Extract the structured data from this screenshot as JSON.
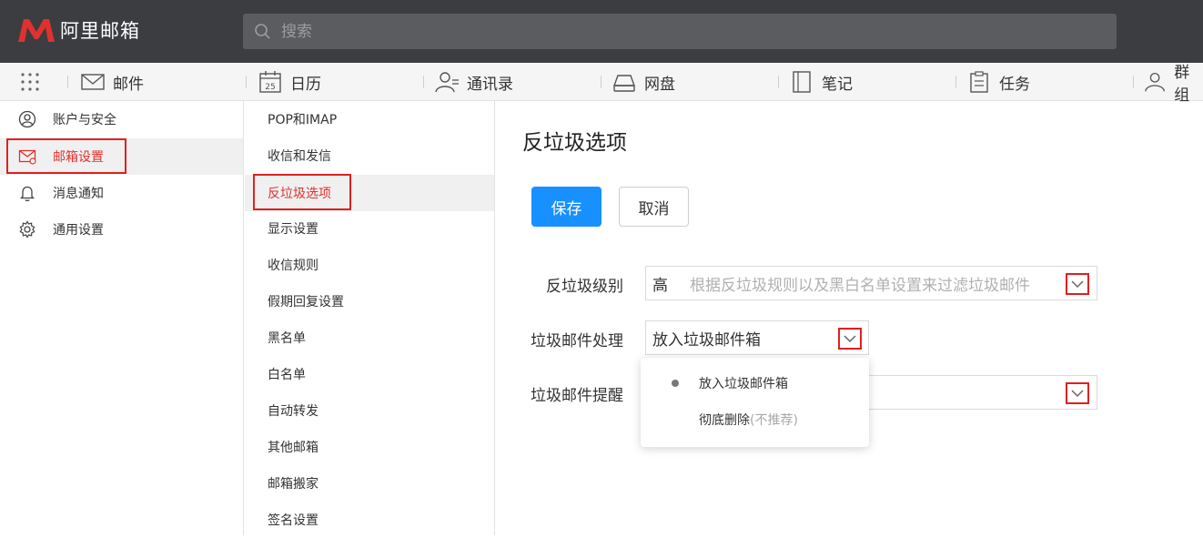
{
  "app": {
    "logo_text": "阿里邮箱",
    "brand_color": "#e0312f"
  },
  "search": {
    "placeholder": "搜索"
  },
  "nav": {
    "items": [
      {
        "label": "邮件",
        "icon": "mail-icon"
      },
      {
        "label": "日历",
        "icon": "calendar-icon",
        "calendar_day": "25"
      },
      {
        "label": "通讯录",
        "icon": "contacts-icon"
      },
      {
        "label": "网盘",
        "icon": "drive-icon"
      },
      {
        "label": "笔记",
        "icon": "notes-icon"
      },
      {
        "label": "任务",
        "icon": "tasks-icon"
      },
      {
        "label": "群组",
        "icon": "groups-icon"
      }
    ]
  },
  "sidebar": {
    "items": [
      {
        "label": "账户与安全",
        "icon": "user-circle-icon"
      },
      {
        "label": "邮箱设置",
        "icon": "mail-settings-icon",
        "active": true
      },
      {
        "label": "消息通知",
        "icon": "bell-icon"
      },
      {
        "label": "通用设置",
        "icon": "gear-icon"
      }
    ]
  },
  "submenu": {
    "items": [
      "POP和IMAP",
      "收信和发信",
      "反垃圾选项",
      "显示设置",
      "收信规则",
      "假期回复设置",
      "黑名单",
      "白名单",
      "自动转发",
      "其他邮箱",
      "邮箱搬家",
      "签名设置"
    ],
    "active": "反垃圾选项"
  },
  "main": {
    "title": "反垃圾选项",
    "save_label": "保存",
    "cancel_label": "取消",
    "fields": {
      "level": {
        "label": "反垃圾级别",
        "value": "高",
        "hint": "根据反垃圾规则以及黑白名单设置来过滤垃圾邮件"
      },
      "handling": {
        "label": "垃圾邮件处理",
        "value": "放入垃圾邮件箱"
      },
      "reminder": {
        "label": "垃圾邮件提醒",
        "value": ""
      }
    }
  },
  "dropdown": {
    "options": [
      {
        "label": "放入垃圾邮件箱",
        "selected": true,
        "note": ""
      },
      {
        "label": "彻底删除",
        "selected": false,
        "note": "(不推荐)"
      }
    ]
  }
}
